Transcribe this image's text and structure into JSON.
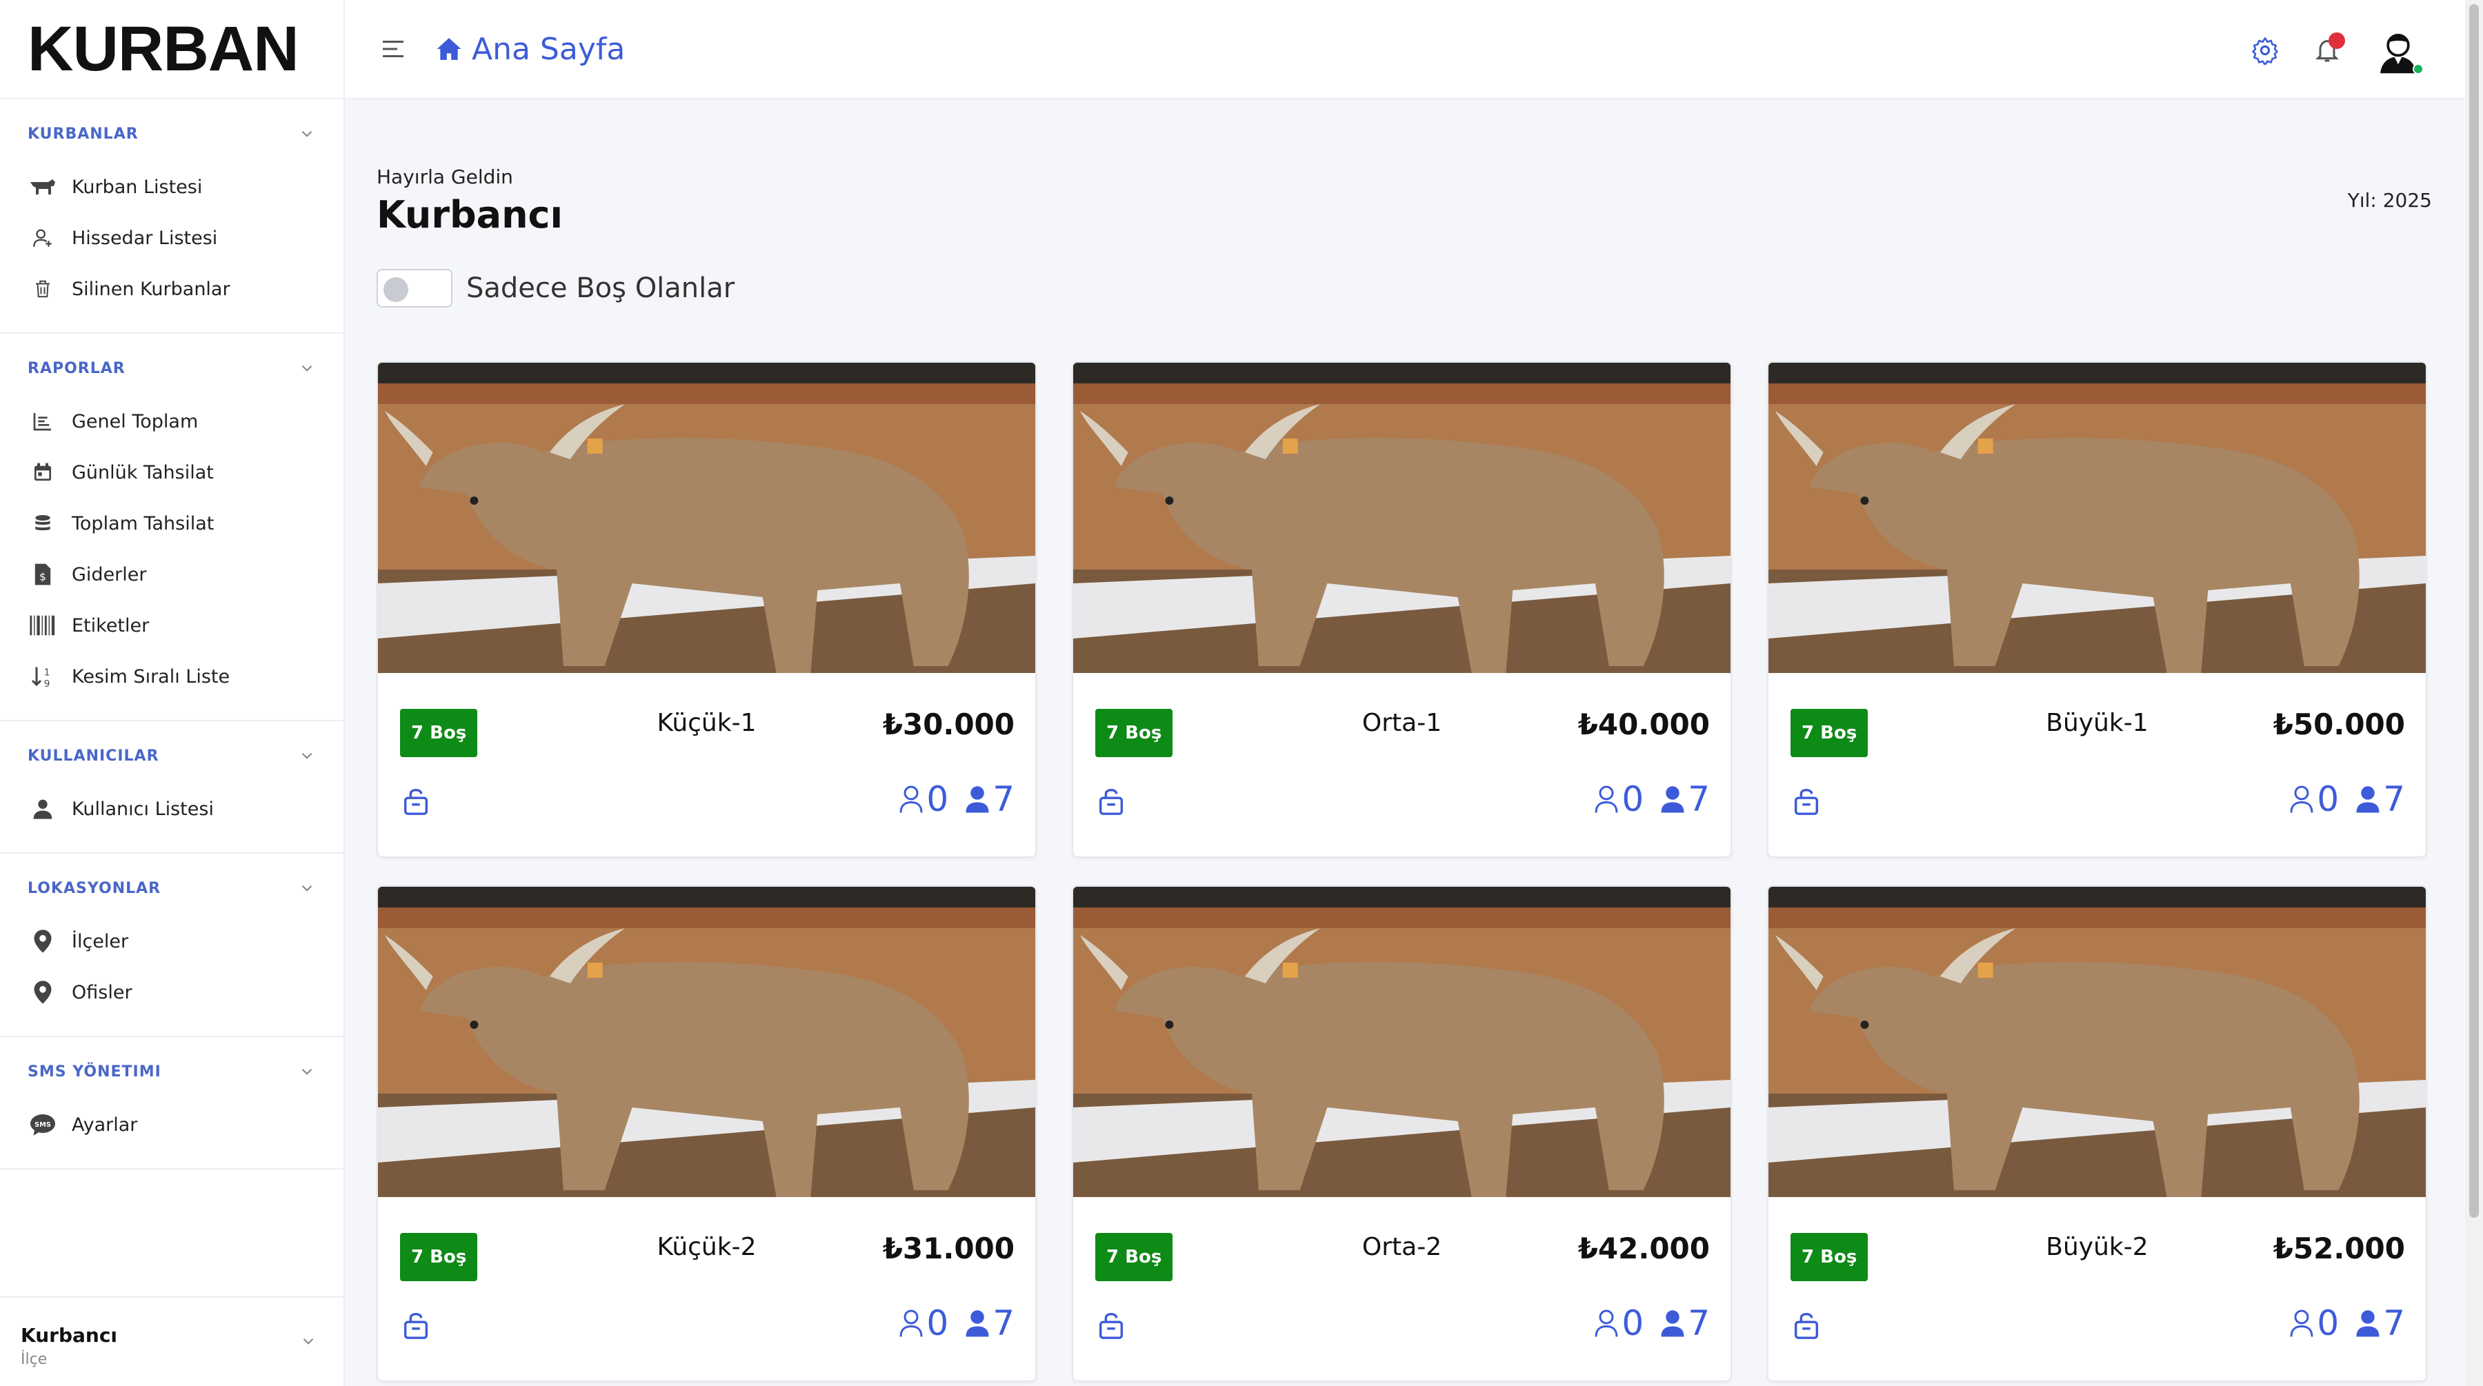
{
  "brand": "KURBAN",
  "topbar": {
    "breadcrumb": "Ana Sayfa"
  },
  "sidebar": {
    "sections": [
      {
        "title": "KURBANLAR",
        "items": [
          {
            "label": "Kurban Listesi",
            "icon": "cow-icon"
          },
          {
            "label": "Hissedar Listesi",
            "icon": "user-plus-icon"
          },
          {
            "label": "Silinen Kurbanlar",
            "icon": "trash-icon"
          }
        ]
      },
      {
        "title": "RAPORLAR",
        "items": [
          {
            "label": "Genel Toplam",
            "icon": "chart-icon"
          },
          {
            "label": "Günlük Tahsilat",
            "icon": "calendar-icon"
          },
          {
            "label": "Toplam Tahsilat",
            "icon": "coins-icon"
          },
          {
            "label": "Giderler",
            "icon": "invoice-icon"
          },
          {
            "label": "Etiketler",
            "icon": "barcode-icon"
          },
          {
            "label": "Kesim Sıralı Liste",
            "icon": "sort-icon"
          }
        ]
      },
      {
        "title": "KULLANICILAR",
        "items": [
          {
            "label": "Kullanıcı Listesi",
            "icon": "user-icon"
          }
        ]
      },
      {
        "title": "LOKASYONLAR",
        "items": [
          {
            "label": "İlçeler",
            "icon": "map-pin-icon"
          },
          {
            "label": "Ofisler",
            "icon": "map-pin-icon"
          }
        ]
      },
      {
        "title": "SMS YÖNETIMI",
        "items": [
          {
            "label": "Ayarlar",
            "icon": "sms-icon"
          }
        ]
      }
    ],
    "footer": {
      "name": "Kurbancı",
      "role": "İlçe"
    }
  },
  "main": {
    "greeting": "Hayırla Geldin",
    "title": "Kurbancı",
    "year": "Yıl: 2025",
    "filter_label": "Sadece Boş Olanlar"
  },
  "cards": [
    {
      "badge": "7 Boş",
      "name": "Küçük-1",
      "price": "₺30.000",
      "filled": "0",
      "total": "7"
    },
    {
      "badge": "7 Boş",
      "name": "Orta-1",
      "price": "₺40.000",
      "filled": "0",
      "total": "7"
    },
    {
      "badge": "7 Boş",
      "name": "Büyük-1",
      "price": "₺50.000",
      "filled": "0",
      "total": "7"
    },
    {
      "badge": "7 Boş",
      "name": "Küçük-2",
      "price": "₺31.000",
      "filled": "0",
      "total": "7"
    },
    {
      "badge": "7 Boş",
      "name": "Orta-2",
      "price": "₺42.000",
      "filled": "0",
      "total": "7"
    },
    {
      "badge": "7 Boş",
      "name": "Büyük-2",
      "price": "₺52.000",
      "filled": "0",
      "total": "7"
    }
  ],
  "colors": {
    "accent": "#3d5bd9",
    "section_title": "#4a66c9",
    "badge": "#0e8a16",
    "notification": "#e0303a"
  }
}
